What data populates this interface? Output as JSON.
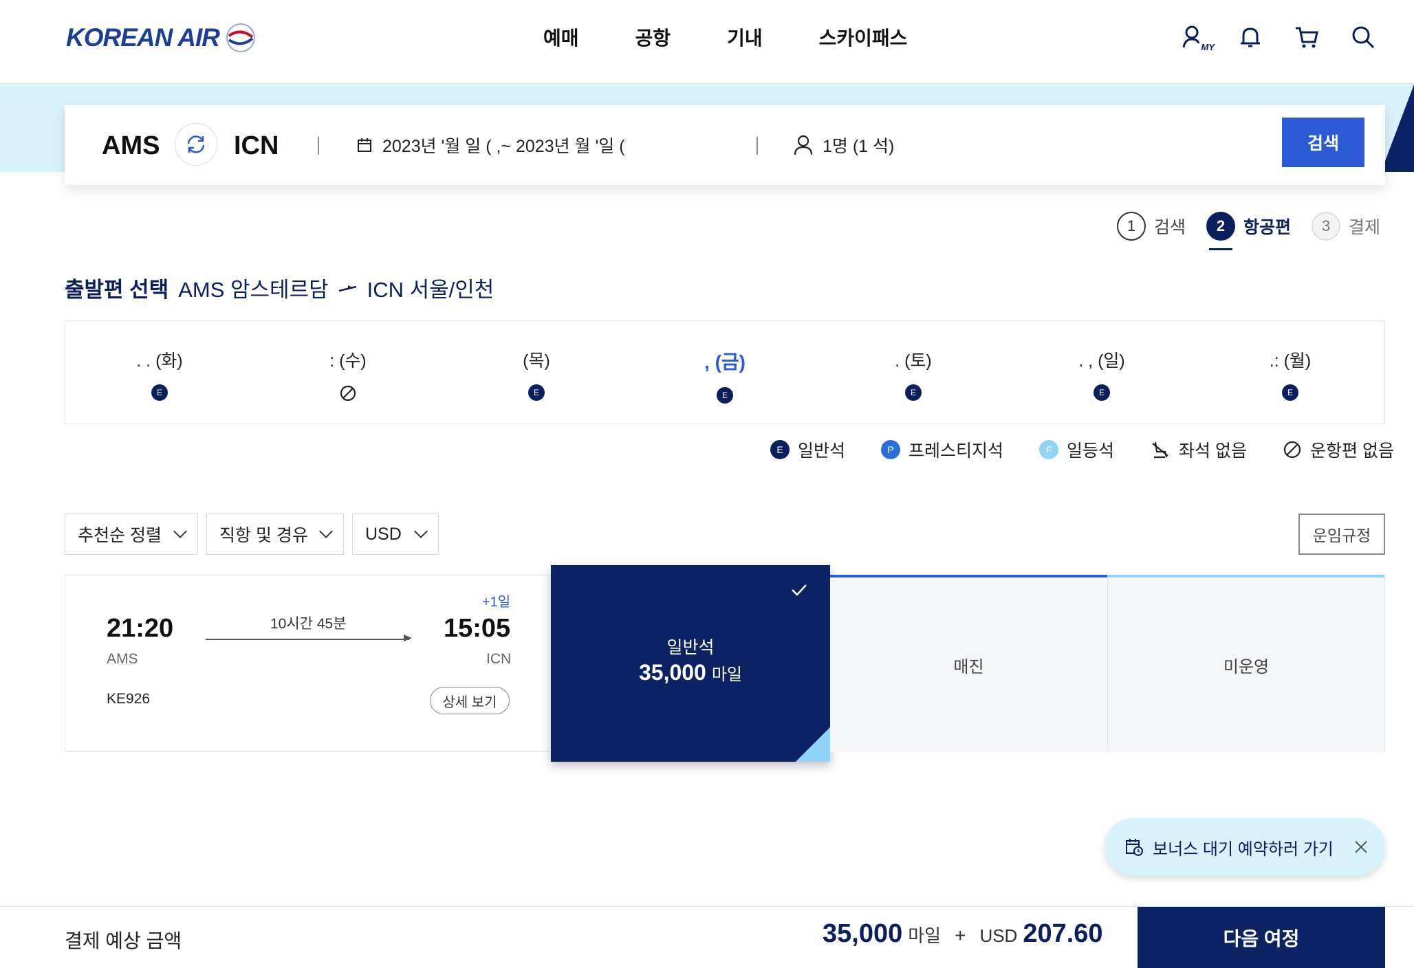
{
  "header": {
    "logo_text": "KOREAN AIR",
    "nav": [
      "예매",
      "공항",
      "기내",
      "스카이패스"
    ],
    "my_label": "MY"
  },
  "search": {
    "origin": "AMS",
    "destination": "ICN",
    "date_range": "2023년  '월   일 (   ,~ 2023년   월   '일 (",
    "passengers": "1명 (1 석)",
    "search_button": "검색"
  },
  "steps": [
    {
      "num": "1",
      "label": "검색",
      "state": "done"
    },
    {
      "num": "2",
      "label": "항공편",
      "state": "active"
    },
    {
      "num": "3",
      "label": "결제",
      "state": "inactive"
    }
  ],
  "section": {
    "title": "출발편 선택",
    "origin": "AMS  암스테르담",
    "destination": "ICN  서울/인천"
  },
  "days": [
    {
      "label": ". . (화)",
      "status": "E"
    },
    {
      "label": ": (수)",
      "status": "none"
    },
    {
      "label": "  (목)",
      "status": "E"
    },
    {
      "label": ", (금)",
      "status": "E",
      "selected": true
    },
    {
      "label": ".  (토)",
      "status": "E"
    },
    {
      "label": ". , (일)",
      "status": "E"
    },
    {
      "label": ".: (월)",
      "status": "E"
    }
  ],
  "legend": [
    {
      "badge": "E",
      "label": "일반석",
      "color": "#0b1f5c"
    },
    {
      "badge": "P",
      "label": "프레스티지석",
      "color": "#2a6fd6"
    },
    {
      "badge": "F",
      "label": "일등석",
      "color": "#8fd3f6"
    },
    {
      "badge": "",
      "label": "좌석 없음"
    },
    {
      "badge": "",
      "label": "운항편 없음"
    }
  ],
  "filters": {
    "sort": "추천순 정렬",
    "stops": "직항 및 경유",
    "currency": "USD",
    "fare_rule": "운임규정"
  },
  "flight": {
    "dep_time": "21:20",
    "dep_code": "AMS",
    "arr_time": "15:05",
    "arr_code": "ICN",
    "plus_day": "+1일",
    "duration": "10시간 45분",
    "flight_no": "KE926",
    "detail_button": "상세 보기"
  },
  "fares": {
    "economy_label": "일반석",
    "economy_miles": "35,000",
    "miles_unit": "마일",
    "prestige": "매진",
    "first": "미운영"
  },
  "bonus_pill": {
    "label": "보너스 대기 예약하러 가기"
  },
  "bottom": {
    "pay_label": "결제 예상 금액",
    "miles": "35,000",
    "miles_unit": "마일",
    "plus": "+",
    "currency": "USD",
    "amount": "207.60",
    "next_button": "다음 여정"
  },
  "colors": {
    "brand_navy": "#0b1f5c",
    "accent_blue": "#2a5ad6",
    "band": "#d8f2fb"
  }
}
